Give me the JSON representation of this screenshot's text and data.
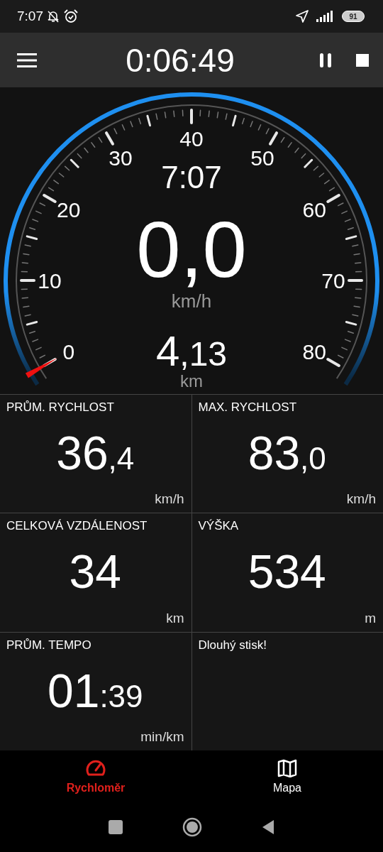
{
  "status_bar": {
    "time": "7:07",
    "battery": "91"
  },
  "toolbar": {
    "elapsed": "0:06:49"
  },
  "gauge": {
    "scale_labels": [
      "0",
      "10",
      "20",
      "30",
      "40",
      "50",
      "60",
      "70",
      "80"
    ],
    "clock": "7:07",
    "speed": "0,0",
    "speed_unit": "km/h",
    "distance_main": "4",
    "distance_fraction": ",13",
    "distance_unit": "km"
  },
  "tiles": [
    {
      "label": "PRŮM. RYCHLOST",
      "value_main": "36",
      "value_fraction": ",4",
      "unit": "km/h"
    },
    {
      "label": "MAX. RYCHLOST",
      "value_main": "83",
      "value_fraction": ",0",
      "unit": "km/h"
    },
    {
      "label": "CELKOVÁ VZDÁLENOST",
      "value_main": "34",
      "unit": "km"
    },
    {
      "label": "VÝŠKA",
      "value_main": "534",
      "unit": "m"
    },
    {
      "label": "PRŮM. TEMPO",
      "value_main": "01",
      "value_fraction": ":39",
      "unit": "min/km"
    },
    {
      "label": "Dlouhý stisk!"
    }
  ],
  "bottom_nav": [
    {
      "label": "Rychloměr",
      "kind": "speedometer",
      "selected": true
    },
    {
      "label": "Mapa",
      "kind": "map",
      "selected": false
    }
  ]
}
